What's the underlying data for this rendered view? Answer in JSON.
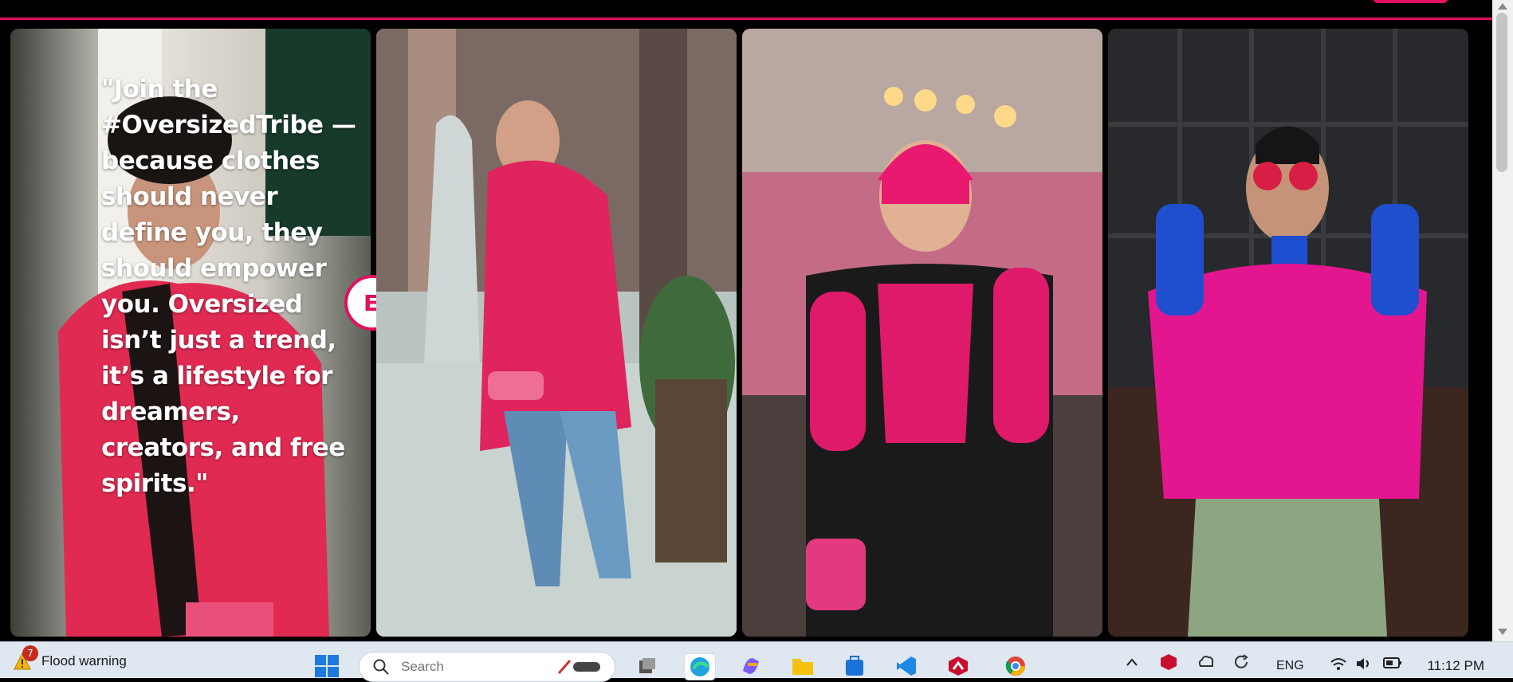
{
  "quote": "\"Join the #OversizedTribe — because clothes should never define you, they should empower you. Oversized isn’t just a trend, it’s a lifestyle for dreamers, creators, and free spirits.\"",
  "overlay_button_letter": "E",
  "gallery": [
    {
      "name": "woman-pink-fleece-coat",
      "accent": "#e31a5c"
    },
    {
      "name": "woman-pink-coat-sidewalk",
      "accent": "#e0245e"
    },
    {
      "name": "woman-pink-beanie-vest",
      "accent": "#e8196e"
    },
    {
      "name": "woman-pink-jacket-red-glasses",
      "accent": "#e3168f"
    }
  ],
  "taskbar": {
    "weather_badge": "7",
    "weather_label": "Flood warning",
    "search_placeholder": "Search",
    "language": "ENG",
    "time": "11:12 PM"
  },
  "colors": {
    "accent": "#e1105d",
    "taskbar_bg": "#dfe7f1"
  },
  "icons": [
    "windows-start-icon",
    "search-icon",
    "task-view-icon",
    "edge-browser-icon",
    "copilot-icon",
    "file-explorer-icon",
    "microsoft-store-icon",
    "vscode-icon",
    "mcafee-icon",
    "chrome-icon",
    "chevron-up-icon",
    "mcafee-tray-icon",
    "network-icon",
    "wifi-icon",
    "volume-icon",
    "battery-icon"
  ]
}
